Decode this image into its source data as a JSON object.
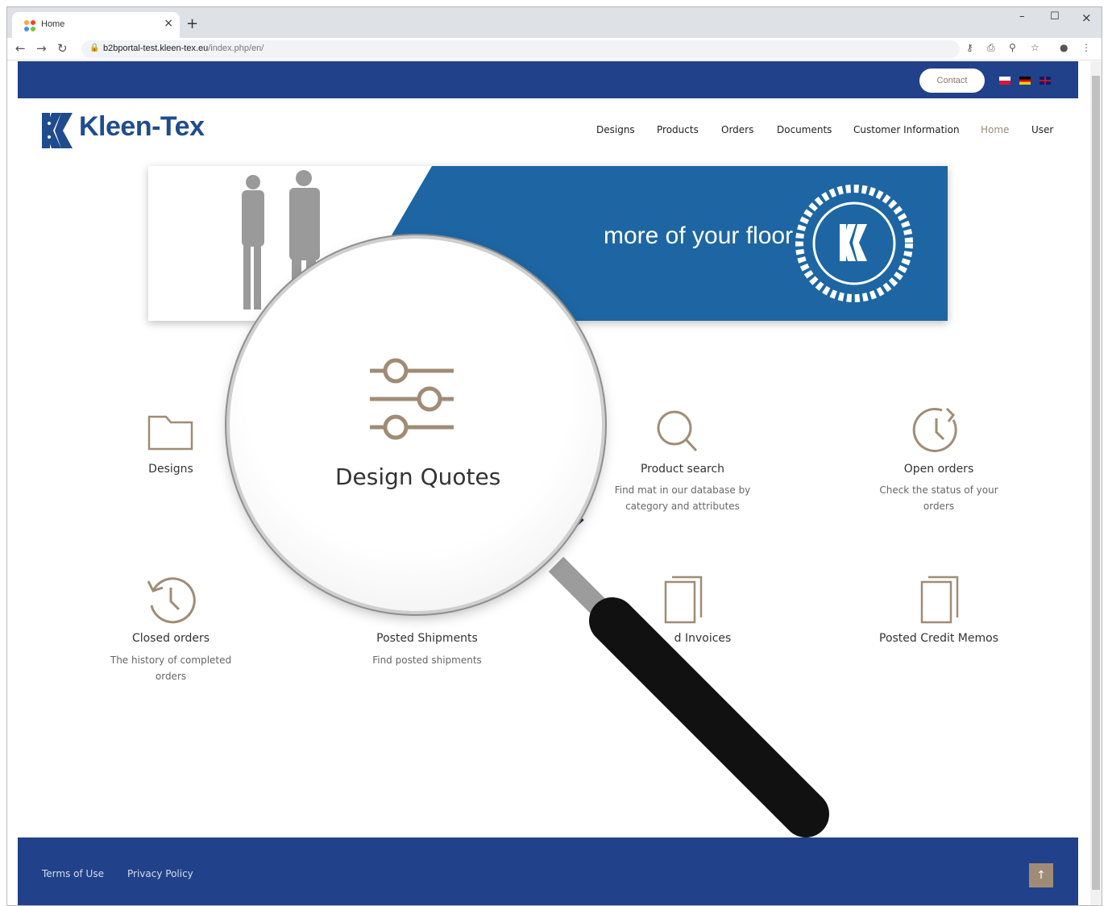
{
  "browser": {
    "tab_title": "Home",
    "tab_close": "×",
    "new_tab": "+",
    "win_min": "–",
    "win_max": "☐",
    "win_close": "×",
    "url_host": "b2bportal-test.kleen-tex.eu",
    "url_path": "/index.php/en/"
  },
  "topbar": {
    "contact_label": "Contact"
  },
  "header": {
    "logo_text": "Kleen-Tex",
    "nav": [
      "Designs",
      "Products",
      "Orders",
      "Documents",
      "Customer Information",
      "Home",
      "User"
    ],
    "active_nav": "Home"
  },
  "banner": {
    "tagline": "more of your floor"
  },
  "tiles": [
    {
      "icon": "folder-icon",
      "title": "Designs",
      "desc": ""
    },
    {
      "icon": "sliders-icon",
      "title": "Design Quotes",
      "desc": ""
    },
    {
      "icon": "search-icon",
      "title": "Product search",
      "desc": "Find mat in our database by category and attributes"
    },
    {
      "icon": "clock-icon",
      "title": "Open orders",
      "desc": "Check the status of your orders"
    },
    {
      "icon": "history-icon",
      "title": "Closed orders",
      "desc": "The history of completed orders"
    },
    {
      "icon": "box-icon",
      "title": "Posted Shipments",
      "desc": "Find posted shipments"
    },
    {
      "icon": "documents-icon",
      "title": "d Invoices",
      "desc": ""
    },
    {
      "icon": "documents-icon",
      "title": "Posted Credit Memos",
      "desc": ""
    }
  ],
  "footer": {
    "terms": "Terms of Use",
    "privacy": "Privacy Policy",
    "back_to_top": "↑"
  },
  "colors": {
    "brand_blue": "#21418a",
    "accent_tan": "#a08c76",
    "logo_blue": "#1f4c8f"
  }
}
